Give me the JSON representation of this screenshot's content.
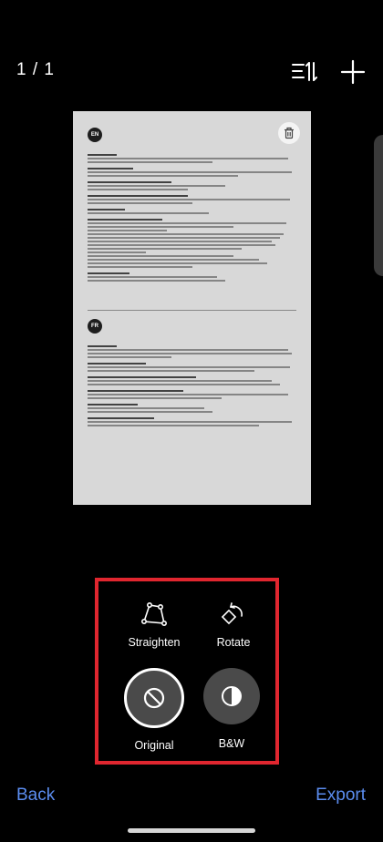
{
  "header": {
    "page_counter": "1 / 1"
  },
  "icons": {
    "sort": "sort-icon",
    "add": "plus-icon",
    "delete": "trash-icon"
  },
  "document": {
    "lang_en": "EN",
    "lang_fr": "FR"
  },
  "tools": {
    "straighten_label": "Straighten",
    "rotate_label": "Rotate",
    "original_label": "Original",
    "bw_label": "B&W"
  },
  "footer": {
    "back_label": "Back",
    "export_label": "Export"
  },
  "colors": {
    "accent": "#5b8def",
    "highlight": "#e0262f"
  }
}
